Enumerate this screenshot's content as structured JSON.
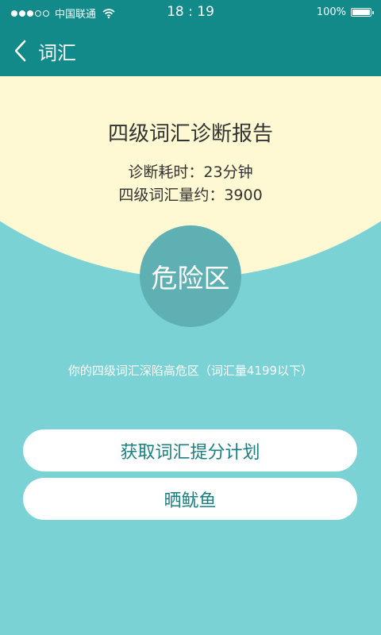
{
  "status_bar": {
    "carrier": "中国联通",
    "time": "18 : 19",
    "battery_text": "100%",
    "battery_level": 1.0
  },
  "nav": {
    "title": "词汇"
  },
  "report": {
    "title": "四级词汇诊断报告",
    "duration": "诊断耗时：23分钟",
    "vocab_estimate": "四级词汇量约：3900"
  },
  "result": {
    "zone_label": "危险区",
    "warning": "你的四级词汇深陷高危区（词汇量4199以下）"
  },
  "actions": {
    "get_plan": "获取词汇提分计划",
    "share": "晒鱿鱼"
  },
  "colors": {
    "header": "#138a8a",
    "cream": "#fef8d3",
    "background": "#7bd2d4",
    "circle": "#5fb0b3",
    "button_text": "#1a7f80"
  }
}
